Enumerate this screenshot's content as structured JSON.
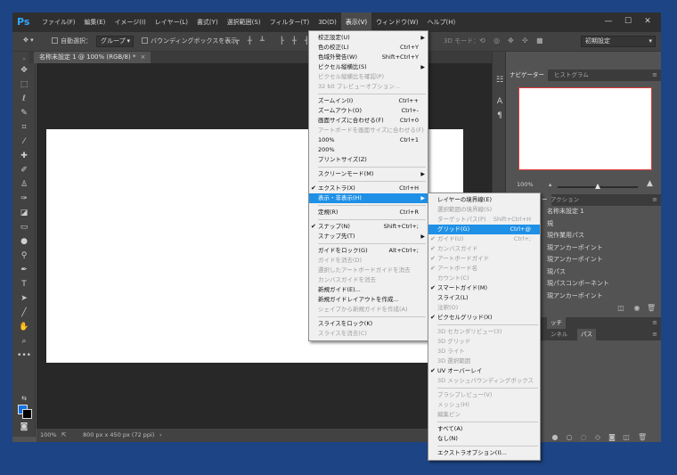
{
  "app": {
    "logo": "Ps"
  },
  "menubar": [
    "ファイル(F)",
    "編集(E)",
    "イメージ(I)",
    "レイヤー(L)",
    "書式(Y)",
    "選択範囲(S)",
    "フィルター(T)",
    "3D(D)",
    "表示(V)",
    "ウィンドウ(W)",
    "ヘルプ(H)"
  ],
  "window_controls": {
    "minimize": "—",
    "restore": "☐",
    "close": "✕"
  },
  "options_bar": {
    "auto_select_label": "自動選択：",
    "group_value": "グループ",
    "bounding_box_label": "バウンディングボックスを表示",
    "mode_3d_label": "3D モード：",
    "workspace_value": "初期設定"
  },
  "document_tab": {
    "label": "名称未設定 1 @ 100% (RGB/8) *",
    "close": "×"
  },
  "status_bar": {
    "zoom": "100%",
    "size": "800 px x 450 px (72 ppi)"
  },
  "navigator_panel": {
    "tabs": [
      "ナビゲーター",
      "ヒストグラム"
    ],
    "zoom": "100%"
  },
  "history_panel": {
    "tabs": [
      "ヒストリー",
      "アクション"
    ],
    "items": [
      "名称未設定 1",
      "規",
      "現作業用パス",
      "現アンカーポイント",
      "現アンカーポイント",
      "現パス",
      "現パスコンポーネント",
      "現アンカーポイント"
    ]
  },
  "lower_panel": {
    "tabs": [
      "ッチ"
    ],
    "subtabs": [
      "ンネル",
      "パス"
    ]
  },
  "view_menu": {
    "items": [
      {
        "label": "校正設定(U)",
        "arrow": true
      },
      {
        "label": "色の校正(L)",
        "shortcut": "Ctrl+Y"
      },
      {
        "label": "色域外警告(W)",
        "shortcut": "Shift+Ctrl+Y"
      },
      {
        "label": "ピクセル縦横比(S)",
        "arrow": true
      },
      {
        "label": "ピクセル縦横比を確認(P)",
        "disabled": true
      },
      {
        "label": "32 bit プレビューオプション...",
        "disabled": true
      },
      {
        "sep": true
      },
      {
        "label": "ズームイン(I)",
        "shortcut": "Ctrl++"
      },
      {
        "label": "ズームアウト(O)",
        "shortcut": "Ctrl+-"
      },
      {
        "label": "画面サイズに合わせる(F)",
        "shortcut": "Ctrl+0"
      },
      {
        "label": "アートボードを画面サイズに合わせる(F)",
        "disabled": true
      },
      {
        "label": "100%",
        "shortcut": "Ctrl+1"
      },
      {
        "label": "200%"
      },
      {
        "label": "プリントサイズ(Z)"
      },
      {
        "sep": true
      },
      {
        "label": "スクリーンモード(M)",
        "arrow": true
      },
      {
        "sep": true
      },
      {
        "label": "エクストラ(X)",
        "shortcut": "Ctrl+H",
        "checked": true
      },
      {
        "label": "表示・非表示(H)",
        "arrow": true,
        "highlight": true
      },
      {
        "sep": true
      },
      {
        "label": "定規(R)",
        "shortcut": "Ctrl+R"
      },
      {
        "sep": true
      },
      {
        "label": "スナップ(N)",
        "shortcut": "Shift+Ctrl+;",
        "checked": true
      },
      {
        "label": "スナップ先(T)",
        "arrow": true
      },
      {
        "sep": true
      },
      {
        "label": "ガイドをロック(G)",
        "shortcut": "Alt+Ctrl+;"
      },
      {
        "label": "ガイドを消去(D)",
        "disabled": true
      },
      {
        "label": "選択したアートボードガイドを消去",
        "disabled": true
      },
      {
        "label": "カンバスガイドを消去",
        "disabled": true
      },
      {
        "label": "新規ガイド(E)..."
      },
      {
        "label": "新規ガイドレイアウトを作成..."
      },
      {
        "label": "シェイプから新規ガイドを作成(A)",
        "disabled": true
      },
      {
        "sep": true
      },
      {
        "label": "スライスをロック(K)"
      },
      {
        "label": "スライスを消去(C)",
        "disabled": true
      }
    ]
  },
  "show_submenu": {
    "items": [
      {
        "label": "レイヤーの境界線(E)"
      },
      {
        "label": "選択範囲の境界線(S)",
        "disabled": true
      },
      {
        "label": "ターゲットパス(P)",
        "shortcut": "Shift+Ctrl+H",
        "disabled": true
      },
      {
        "label": "グリッド(G)",
        "shortcut": "Ctrl+@",
        "highlight": true
      },
      {
        "label": "ガイド(U)",
        "shortcut": "Ctrl+;",
        "checked": true,
        "disabled": true
      },
      {
        "label": "カンバスガイド",
        "checked": true,
        "disabled": true
      },
      {
        "label": "アートボードガイド",
        "checked": true,
        "disabled": true
      },
      {
        "label": "アートボード名",
        "checked": true,
        "disabled": true
      },
      {
        "label": "カウント(C)",
        "disabled": true
      },
      {
        "label": "スマートガイド(M)",
        "checked": true
      },
      {
        "label": "スライス(L)"
      },
      {
        "label": "注釈(O)",
        "disabled": true
      },
      {
        "label": "ピクセルグリッド(X)",
        "checked": true
      },
      {
        "sep": true
      },
      {
        "label": "3D セカンダリビュー(3)",
        "disabled": true
      },
      {
        "label": "3D グリッド",
        "disabled": true
      },
      {
        "label": "3D ライト",
        "disabled": true
      },
      {
        "label": "3D 選択範囲",
        "disabled": true
      },
      {
        "label": "UV オーバーレイ",
        "checked": true
      },
      {
        "label": "3D メッシュバウンディングボックス",
        "disabled": true
      },
      {
        "sep": true
      },
      {
        "label": "ブラシプレビュー(V)",
        "disabled": true
      },
      {
        "label": "メッシュ(H)",
        "disabled": true
      },
      {
        "label": "編集ピン",
        "disabled": true
      },
      {
        "sep": true
      },
      {
        "label": "すべて(A)"
      },
      {
        "label": "なし(N)"
      },
      {
        "sep": true
      },
      {
        "label": "エクストラオプション(I)..."
      }
    ]
  },
  "colors": {
    "accent": "#1e90e6",
    "fg_color": "#1573e6",
    "bg_color": "#000000"
  }
}
